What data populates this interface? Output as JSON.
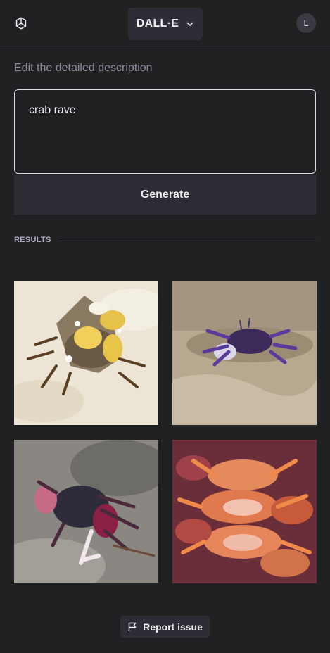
{
  "header": {
    "logo_icon": "openai-logo-icon",
    "model_label": "DALL·E",
    "model_chevron_icon": "chevron-down-icon",
    "avatar_initial": "L"
  },
  "editor": {
    "instruction": "Edit the detailed description",
    "prompt_value": "crab rave",
    "generate_label": "Generate"
  },
  "results": {
    "label": "RESULTS",
    "images": [
      {
        "subject": "yellow-white crabs on sand"
      },
      {
        "subject": "purple crab on wet sand"
      },
      {
        "subject": "red-purple crab on gray sand"
      },
      {
        "subject": "pile of orange crabs"
      }
    ]
  },
  "footer": {
    "report_label": "Report issue",
    "report_icon": "flag-icon"
  },
  "colors": {
    "background": "#202123",
    "surface": "#2d2e35",
    "text": "#ececf1",
    "muted": "#8e8ea0"
  }
}
